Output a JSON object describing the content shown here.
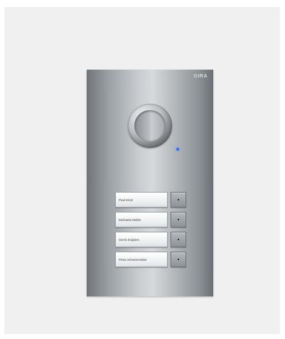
{
  "brand": "GIRA",
  "panel": {
    "led_color": "#2f6dff",
    "names": [
      "Paul Klotz",
      "Michaela Müller",
      "Gerrit Snijders",
      "Petra Schoenmaker"
    ]
  },
  "icons": {
    "speaker": "speaker-icon",
    "led": "status-led-icon"
  }
}
